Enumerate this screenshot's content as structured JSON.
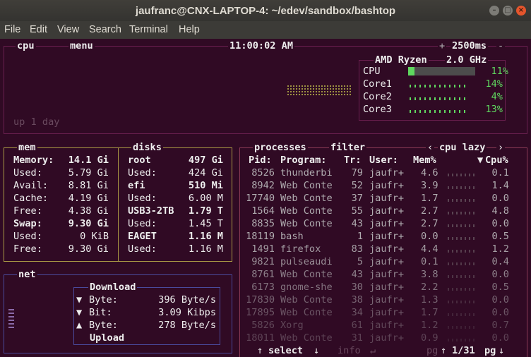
{
  "window": {
    "title": "jaufranc@CNX-LAPTOP-4: ~/edev/sandbox/bashtop"
  },
  "menu": [
    "File",
    "Edit",
    "View",
    "Search",
    "Terminal",
    "Help"
  ],
  "cpu_box": {
    "label": "cpu",
    "menu_label": "menu",
    "clock": "11:00:02 AM",
    "interval": "2500ms",
    "plus": "+",
    "minus": "-",
    "uptime": "up 1 day",
    "model": "AMD Ryzen",
    "freq": "2.0 GHz",
    "rows": [
      {
        "name": "CPU",
        "pct": "11%",
        "value": 0.11
      },
      {
        "name": "Core1",
        "pct": "14%",
        "value": 0.14
      },
      {
        "name": "Core2",
        "pct": "4%",
        "value": 0.04
      },
      {
        "name": "Core3",
        "pct": "13%",
        "value": 0.13
      }
    ]
  },
  "mem_box": {
    "label": "mem",
    "rows": [
      {
        "k": "Memory:",
        "v": "14.1 Gi",
        "bold": true
      },
      {
        "k": "Used:",
        "v": "5.79 Gi",
        "bold": false
      },
      {
        "k": "Avail:",
        "v": "8.81 Gi",
        "bold": false
      },
      {
        "k": "Cache:",
        "v": "4.19 Gi",
        "bold": false
      },
      {
        "k": "Free:",
        "v": "4.38 Gi",
        "bold": false
      },
      {
        "k": "Swap:",
        "v": "9.30 Gi",
        "bold": true
      },
      {
        "k": "Used:",
        "v": "0 KiB",
        "bold": false
      },
      {
        "k": "Free:",
        "v": "9.30 Gi",
        "bold": false
      }
    ]
  },
  "disks_box": {
    "label": "disks",
    "rows": [
      {
        "k": "root",
        "v": "497 Gi",
        "bold": true
      },
      {
        "k": "Used:",
        "v": "424 Gi",
        "bold": false
      },
      {
        "k": "efi",
        "v": "510 Mi",
        "bold": true
      },
      {
        "k": "Used:",
        "v": "6.00 M",
        "bold": false
      },
      {
        "k": "USB3-2TB",
        "v": "1.79 T",
        "bold": true
      },
      {
        "k": "Used:",
        "v": "1.45 T",
        "bold": false
      },
      {
        "k": "EAGET",
        "v": "1.16 M",
        "bold": true
      },
      {
        "k": "Used:",
        "v": "1.16 M",
        "bold": false
      }
    ]
  },
  "net_box": {
    "label": "net",
    "download": "Download",
    "upload": "Upload",
    "rows": [
      {
        "arrow": "▼",
        "k": "Byte:",
        "v": "396 Byte/s"
      },
      {
        "arrow": "▼",
        "k": "Bit:",
        "v": "3.09 Kibps"
      },
      {
        "arrow": "▲",
        "k": "Byte:",
        "v": "278 Byte/s"
      }
    ]
  },
  "proc_box": {
    "label": "processes",
    "filter": "filter",
    "sort": "cpu lazy",
    "sort_left": "‹",
    "sort_right": "›",
    "headers": {
      "pid": "Pid:",
      "program": "Program:",
      "tr": "Tr:",
      "user": "User:",
      "mem": "Mem%",
      "cpu": "Cpu%",
      "sort_arrow": "▼"
    },
    "rows": [
      {
        "pid": "8526",
        "program": "thunderbi",
        "tr": "79",
        "user": "jaufr+",
        "mem": "4.6",
        "cpu": "0.1"
      },
      {
        "pid": "8942",
        "program": "Web Conte",
        "tr": "52",
        "user": "jaufr+",
        "mem": "3.9",
        "cpu": "1.4"
      },
      {
        "pid": "17740",
        "program": "Web Conte",
        "tr": "37",
        "user": "jaufr+",
        "mem": "1.7",
        "cpu": "0.0"
      },
      {
        "pid": "1564",
        "program": "Web Conte",
        "tr": "55",
        "user": "jaufr+",
        "mem": "2.7",
        "cpu": "4.8"
      },
      {
        "pid": "8835",
        "program": "Web Conte",
        "tr": "43",
        "user": "jaufr+",
        "mem": "2.7",
        "cpu": "0.0"
      },
      {
        "pid": "18119",
        "program": "bash",
        "tr": "1",
        "user": "jaufr+",
        "mem": "0.0",
        "cpu": "0.5"
      },
      {
        "pid": "1491",
        "program": "firefox",
        "tr": "83",
        "user": "jaufr+",
        "mem": "4.4",
        "cpu": "1.2"
      },
      {
        "pid": "9821",
        "program": "pulseaudi",
        "tr": "5",
        "user": "jaufr+",
        "mem": "0.1",
        "cpu": "0.4"
      },
      {
        "pid": "8761",
        "program": "Web Conte",
        "tr": "43",
        "user": "jaufr+",
        "mem": "3.8",
        "cpu": "0.0"
      },
      {
        "pid": "6173",
        "program": "gnome-she",
        "tr": "30",
        "user": "jaufr+",
        "mem": "2.2",
        "cpu": "0.5"
      },
      {
        "pid": "17830",
        "program": "Web Conte",
        "tr": "38",
        "user": "jaufr+",
        "mem": "1.3",
        "cpu": "0.0"
      },
      {
        "pid": "17895",
        "program": "Web Conte",
        "tr": "34",
        "user": "jaufr+",
        "mem": "1.7",
        "cpu": "0.0"
      },
      {
        "pid": "5826",
        "program": "Xorg",
        "tr": "61",
        "user": "jaufr+",
        "mem": "1.2",
        "cpu": "0.7"
      },
      {
        "pid": "18011",
        "program": "Web Conte",
        "tr": "31",
        "user": "jaufr+",
        "mem": "0.9",
        "cpu": "0.0"
      }
    ],
    "footer": {
      "up": "↑",
      "select": "select",
      "down": "↓",
      "info": "info",
      "enter": "↵",
      "pg": "pg",
      "pg_up": "↑",
      "page": "1/31",
      "pg_down": "↓"
    }
  },
  "colors": {
    "cpu_border": "#6a1f4f",
    "mem_border": "#a99945",
    "net_border": "#4a4a9c",
    "proc_border": "#8a3a55",
    "accent_green": "#5fd75f",
    "text": "#eeeeee",
    "dim": "#b0acb0"
  }
}
